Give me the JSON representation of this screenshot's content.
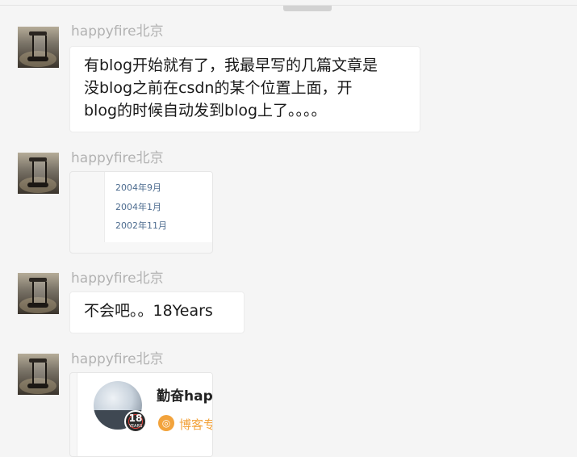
{
  "messages": [
    {
      "sender": "happyfire北京",
      "text": "有blog开始就有了，我最早写的几篇文章是\n没blog之前在csdn的某个位置上面，开\nblog的时候自动发到blog上了。。。。"
    },
    {
      "sender": "happyfire北京",
      "dates": [
        "2004年9月",
        "2004年1月",
        "2002年11月"
      ]
    },
    {
      "sender": "happyfire北京",
      "text": "不会吧。。18Years"
    },
    {
      "sender": "happyfire北京",
      "profile_card": {
        "name": "勤奋happy",
        "badge_number": "18",
        "badge_text": "YEARS",
        "blog_expert_label": "博客专家"
      }
    }
  ],
  "icons": {
    "avatar": "hourglass-photo-avatar",
    "blog_expert": "blog-expert-icon"
  },
  "colors": {
    "background": "#f5f5f5",
    "sender_name": "#b2b2b2",
    "link": "#4d6c8f",
    "expert_orange": "#f2a33c",
    "badge_ring": "#e3413a"
  }
}
